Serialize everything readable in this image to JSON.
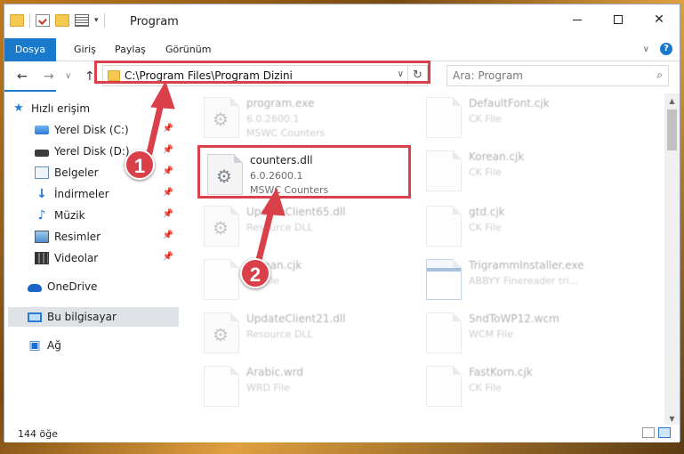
{
  "window": {
    "title": "Program",
    "min_icon": "minimize-icon",
    "max_icon": "maximize-icon",
    "close_glyph": "✕"
  },
  "ribbon": {
    "tabs": [
      "Dosya",
      "Giriş",
      "Paylaş",
      "Görünüm"
    ],
    "help": "?"
  },
  "nav": {
    "back": "←",
    "forward": "→",
    "recent": "∨",
    "up": "↑",
    "path": "C:\\Program Files\\Program Dizini",
    "refresh": "↻",
    "search_placeholder": "Ara: Program",
    "search_icon": "⌕"
  },
  "sidebar": {
    "items": [
      {
        "label": "Hızlı erişim",
        "icon": "star-icon"
      },
      {
        "label": "Yerel Disk (C:)",
        "icon": "drive-icon"
      },
      {
        "label": "Yerel Disk (D:)",
        "icon": "drive-icon"
      },
      {
        "label": "Belgeler",
        "icon": "documents-icon"
      },
      {
        "label": "İndirmeler",
        "icon": "download-icon"
      },
      {
        "label": "Müzik",
        "icon": "music-icon"
      },
      {
        "label": "Resimler",
        "icon": "pictures-icon"
      },
      {
        "label": "Videolar",
        "icon": "videos-icon"
      },
      {
        "label": "OneDrive",
        "icon": "cloud-icon"
      },
      {
        "label": "Bu bilgisayar",
        "icon": "computer-icon"
      },
      {
        "label": "Ağ",
        "icon": "network-icon"
      }
    ]
  },
  "files": [
    {
      "name": "program.exe",
      "l2": "6.0.2600.1",
      "l3": "MSWC Counters"
    },
    {
      "name": "DefaultFont.cjk",
      "l2": "CK File",
      "l3": ""
    },
    {
      "name": "counters.dll",
      "l2": "6.0.2600.1",
      "l3": "MSWC Counters"
    },
    {
      "name": "Korean.cjk",
      "l2": "CK File",
      "l3": ""
    },
    {
      "name": "UpdateClient65.dll",
      "l2": "Resource DLL",
      "l3": ""
    },
    {
      "name": "gtd.cjk",
      "l2": "CK File",
      "l3": ""
    },
    {
      "name": "Korean.cjk",
      "l2": "CK File",
      "l3": ""
    },
    {
      "name": "TrigrammInstaller.exe",
      "l2": "ABBYY Finereader tri...",
      "l3": ""
    },
    {
      "name": "UpdateClient21.dll",
      "l2": "Resource DLL",
      "l3": ""
    },
    {
      "name": "SndToWP12.wcm",
      "l2": "WCM File",
      "l3": ""
    },
    {
      "name": "Arabic.wrd",
      "l2": "WRD File",
      "l3": ""
    },
    {
      "name": "FastKorn.cjk",
      "l2": "CK File",
      "l3": ""
    }
  ],
  "status": {
    "count": "144 öğe"
  },
  "annotations": {
    "step1": "1",
    "step2": "2"
  },
  "colors": {
    "accent": "#1979ca",
    "highlight": "#d9404a"
  }
}
